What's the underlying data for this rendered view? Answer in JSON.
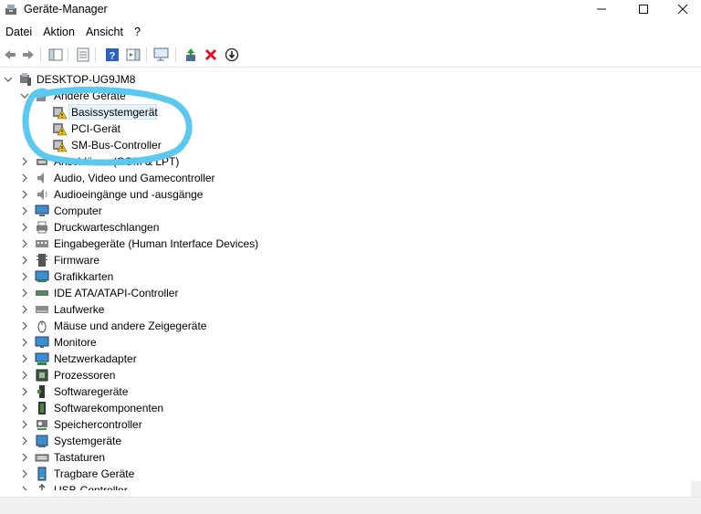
{
  "window": {
    "title": "Geräte-Manager",
    "controls": {
      "minimize": "—",
      "maximize": "☐",
      "close": "✕"
    }
  },
  "menu": [
    "Datei",
    "Aktion",
    "Ansicht",
    "?"
  ],
  "toolbar": [
    "back-arrow-icon",
    "forward-arrow-icon",
    "show-hide-console-tree-icon",
    "properties-icon",
    "help-icon",
    "action-pane-icon",
    "scan-hardware-icon",
    "update-driver-icon",
    "uninstall-device-icon",
    "disable-device-icon"
  ],
  "tree": {
    "root": "DESKTOP-UG9JM8",
    "other_devices": {
      "label": "Andere Geräte",
      "children": [
        "Basissystemgerät",
        "PCI-Gerät",
        "SM-Bus-Controller"
      ]
    },
    "categories": [
      "Anschlüsse (COM & LPT)",
      "Audio, Video und Gamecontroller",
      "Audioeingänge und -ausgänge",
      "Computer",
      "Druckwarteschlangen",
      "Eingabegeräte (Human Interface Devices)",
      "Firmware",
      "Grafikkarten",
      "IDE ATA/ATAPI-Controller",
      "Laufwerke",
      "Mäuse und andere Zeigegeräte",
      "Monitore",
      "Netzwerkadapter",
      "Prozessoren",
      "Softwaregeräte",
      "Softwarekomponenten",
      "Speichercontroller",
      "Systemgeräte",
      "Tastaturen",
      "Tragbare Geräte",
      "USB-Controller"
    ]
  },
  "colors": {
    "selection": "#e5f1fb",
    "annotation_circle": "#5bc8f0",
    "warning": "#f5c400",
    "uninstall_red": "#e0141e"
  }
}
